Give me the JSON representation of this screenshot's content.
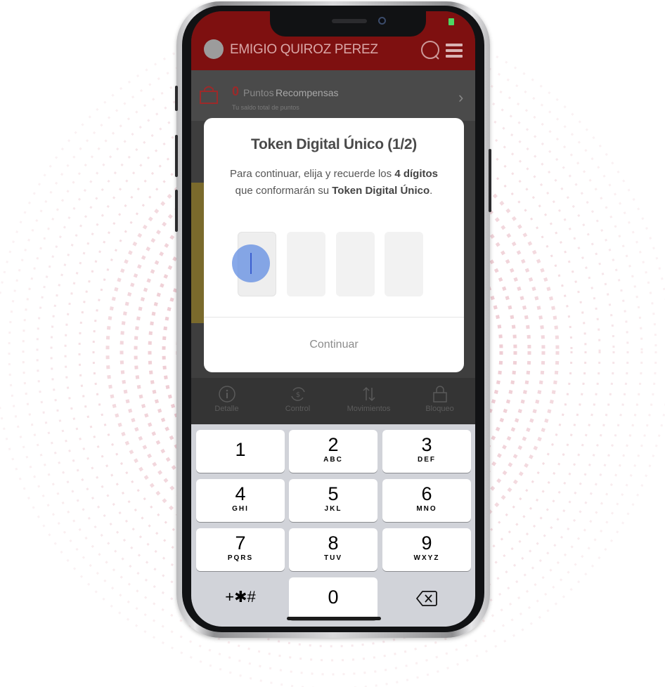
{
  "app": {
    "user_name": "EMIGIO QUIROZ PEREZ",
    "brand_color": "#c41414"
  },
  "rewards": {
    "points": "0",
    "points_label": "Puntos",
    "rewards_label": "Recompensas",
    "subtitle": "Tu saldo total de puntos"
  },
  "dialog": {
    "title": "Token Digital Único (1/2)",
    "text_part1": "Para continuar, elija y recuerde los ",
    "text_bold1": "4 dígitos",
    "text_part2": " que conformarán su ",
    "text_bold2": "Token Digital Único",
    "text_part3": ".",
    "continue_label": "Continuar",
    "digits": [
      "",
      "",
      "",
      ""
    ]
  },
  "tabs": [
    {
      "label": "Detalle",
      "icon": "info-icon"
    },
    {
      "label": "Control",
      "icon": "money-cycle-icon"
    },
    {
      "label": "Movimientos",
      "icon": "transfer-arrows-icon"
    },
    {
      "label": "Bloqueo",
      "icon": "lock-icon"
    }
  ],
  "keyboard": {
    "keys": [
      {
        "num": "1",
        "sub": ""
      },
      {
        "num": "2",
        "sub": "ABC"
      },
      {
        "num": "3",
        "sub": "DEF"
      },
      {
        "num": "4",
        "sub": "GHI"
      },
      {
        "num": "5",
        "sub": "JKL"
      },
      {
        "num": "6",
        "sub": "MNO"
      },
      {
        "num": "7",
        "sub": "PQRS"
      },
      {
        "num": "8",
        "sub": "TUV"
      },
      {
        "num": "9",
        "sub": "WXYZ"
      }
    ],
    "symbols": "+✱#",
    "zero": "0",
    "delete_icon": "backspace-icon"
  }
}
